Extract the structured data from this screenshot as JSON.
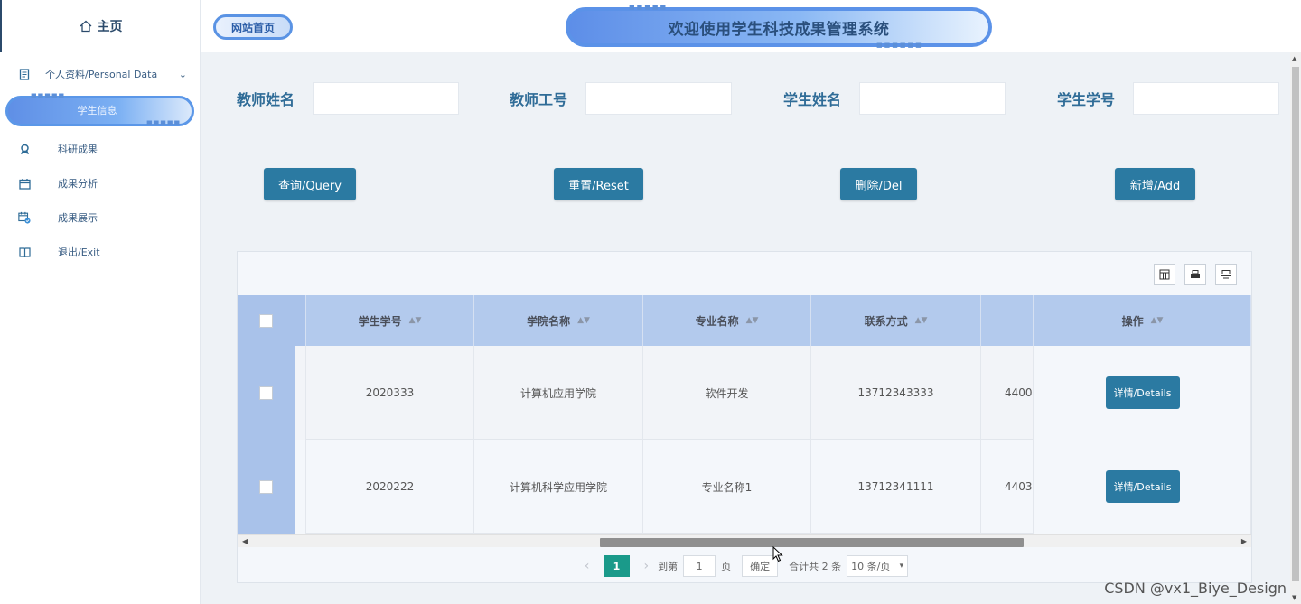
{
  "sidebar": {
    "home_label": "主页",
    "parent_label": "个人资料/Personal Data",
    "active_item": "学生信息",
    "items": [
      {
        "label": "科研成果",
        "icon": "award-icon"
      },
      {
        "label": "成果分析",
        "icon": "calendar-icon"
      },
      {
        "label": "成果展示",
        "icon": "calendar-check-icon"
      },
      {
        "label": "退出/Exit",
        "icon": "book-icon"
      }
    ]
  },
  "topbar": {
    "site_home": "网站首页",
    "banner_title": "欢迎使用学生科技成果管理系统"
  },
  "search": {
    "teacher_name_label": "教师姓名",
    "teacher_id_label": "教师工号",
    "student_name_label": "学生姓名",
    "student_id_label": "学生学号"
  },
  "actions": {
    "query": "查询/Query",
    "reset": "重置/Reset",
    "delete": "删除/Del",
    "add": "新增/Add"
  },
  "table": {
    "headers": [
      "学生学号",
      "学院名称",
      "专业名称",
      "联系方式",
      "操作"
    ],
    "rows": [
      {
        "student_id": "2020333",
        "college": "计算机应用学院",
        "major": "软件开发",
        "phone": "13712343333",
        "extra": "4400",
        "detail": "详情/Details"
      },
      {
        "student_id": "2020222",
        "college": "计算机科学应用学院",
        "major": "专业名称1",
        "phone": "13712341111",
        "extra": "4403",
        "detail": "详情/Details"
      }
    ]
  },
  "pagination": {
    "current_page": "1",
    "goto_label": "到第",
    "page_input": "1",
    "page_unit": "页",
    "confirm": "确定",
    "total": "合计共 2 条",
    "page_size": "10 条/页"
  },
  "watermark": "CSDN @vx1_Biye_Design",
  "colors": {
    "primary": "#2b7aa2",
    "header_bg": "#b3caed",
    "pager_active": "#1a9a8a"
  }
}
